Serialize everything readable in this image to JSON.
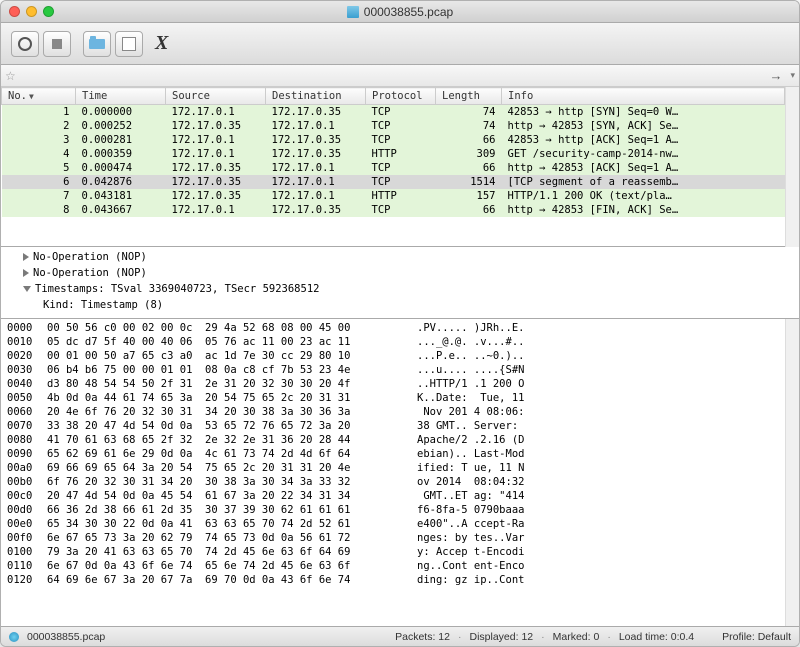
{
  "title": "000038855.pcap",
  "filter_placeholder": "",
  "columns": [
    "No.",
    "Time",
    "Source",
    "Destination",
    "Protocol",
    "Length",
    "Info"
  ],
  "sort_col": 0,
  "packets": [
    {
      "no": 1,
      "time": "0.000000",
      "src": "172.17.0.1",
      "dst": "172.17.0.35",
      "proto": "TCP",
      "len": 74,
      "info": "42853 → http [SYN] Seq=0 W…",
      "sel": false
    },
    {
      "no": 2,
      "time": "0.000252",
      "src": "172.17.0.35",
      "dst": "172.17.0.1",
      "proto": "TCP",
      "len": 74,
      "info": "http → 42853 [SYN, ACK] Se…",
      "sel": false
    },
    {
      "no": 3,
      "time": "0.000281",
      "src": "172.17.0.1",
      "dst": "172.17.0.35",
      "proto": "TCP",
      "len": 66,
      "info": "42853 → http [ACK] Seq=1 A…",
      "sel": false
    },
    {
      "no": 4,
      "time": "0.000359",
      "src": "172.17.0.1",
      "dst": "172.17.0.35",
      "proto": "HTTP",
      "len": 309,
      "info": "GET /security-camp-2014-nw…",
      "sel": false
    },
    {
      "no": 5,
      "time": "0.000474",
      "src": "172.17.0.35",
      "dst": "172.17.0.1",
      "proto": "TCP",
      "len": 66,
      "info": "http → 42853 [ACK] Seq=1 A…",
      "sel": false
    },
    {
      "no": 6,
      "time": "0.042876",
      "src": "172.17.0.35",
      "dst": "172.17.0.1",
      "proto": "TCP",
      "len": 1514,
      "info": "[TCP segment of a reassemb…",
      "sel": true
    },
    {
      "no": 7,
      "time": "0.043181",
      "src": "172.17.0.35",
      "dst": "172.17.0.1",
      "proto": "HTTP",
      "len": 157,
      "info": "HTTP/1.1 200 OK  (text/pla…",
      "sel": false
    },
    {
      "no": 8,
      "time": "0.043667",
      "src": "172.17.0.1",
      "dst": "172.17.0.35",
      "proto": "TCP",
      "len": 66,
      "info": "http → 42853 [FIN, ACK] Se…",
      "sel": false
    }
  ],
  "details": [
    {
      "indent": 1,
      "expanded": false,
      "text": "No-Operation (NOP)"
    },
    {
      "indent": 1,
      "expanded": false,
      "text": "No-Operation (NOP)"
    },
    {
      "indent": 1,
      "expanded": true,
      "text": "Timestamps: TSval 3369040723, TSecr 592368512"
    },
    {
      "indent": 2,
      "expanded": null,
      "text": "Kind: Timestamp (8)"
    }
  ],
  "hex": [
    {
      "off": "0000",
      "b": "00 50 56 c0 00 02 00 0c  29 4a 52 68 08 00 45 00",
      "a": ".PV..... )JRh..E."
    },
    {
      "off": "0010",
      "b": "05 dc d7 5f 40 00 40 06  05 76 ac 11 00 23 ac 11",
      "a": "..._@.@. .v...#.."
    },
    {
      "off": "0020",
      "b": "00 01 00 50 a7 65 c3 a0  ac 1d 7e 30 cc 29 80 10",
      "a": "...P.e.. ..~0.).."
    },
    {
      "off": "0030",
      "b": "06 b4 b6 75 00 00 01 01  08 0a c8 cf 7b 53 23 4e",
      "a": "...u.... ....{S#N"
    },
    {
      "off": "0040",
      "b": "d3 80 48 54 54 50 2f 31  2e 31 20 32 30 30 20 4f",
      "a": "..HTTP/1 .1 200 O"
    },
    {
      "off": "0050",
      "b": "4b 0d 0a 44 61 74 65 3a  20 54 75 65 2c 20 31 31",
      "a": "K..Date:  Tue, 11"
    },
    {
      "off": "0060",
      "b": "20 4e 6f 76 20 32 30 31  34 20 30 38 3a 30 36 3a",
      "a": " Nov 201 4 08:06:"
    },
    {
      "off": "0070",
      "b": "33 38 20 47 4d 54 0d 0a  53 65 72 76 65 72 3a 20",
      "a": "38 GMT.. Server: "
    },
    {
      "off": "0080",
      "b": "41 70 61 63 68 65 2f 32  2e 32 2e 31 36 20 28 44",
      "a": "Apache/2 .2.16 (D"
    },
    {
      "off": "0090",
      "b": "65 62 69 61 6e 29 0d 0a  4c 61 73 74 2d 4d 6f 64",
      "a": "ebian).. Last-Mod"
    },
    {
      "off": "00a0",
      "b": "69 66 69 65 64 3a 20 54  75 65 2c 20 31 31 20 4e",
      "a": "ified: T ue, 11 N"
    },
    {
      "off": "00b0",
      "b": "6f 76 20 32 30 31 34 20  30 38 3a 30 34 3a 33 32",
      "a": "ov 2014  08:04:32"
    },
    {
      "off": "00c0",
      "b": "20 47 4d 54 0d 0a 45 54  61 67 3a 20 22 34 31 34",
      "a": " GMT..ET ag: \"414"
    },
    {
      "off": "00d0",
      "b": "66 36 2d 38 66 61 2d 35  30 37 39 30 62 61 61 61",
      "a": "f6-8fa-5 0790baaa"
    },
    {
      "off": "00e0",
      "b": "65 34 30 30 22 0d 0a 41  63 63 65 70 74 2d 52 61",
      "a": "e400\"..A ccept-Ra"
    },
    {
      "off": "00f0",
      "b": "6e 67 65 73 3a 20 62 79  74 65 73 0d 0a 56 61 72",
      "a": "nges: by tes..Var"
    },
    {
      "off": "0100",
      "b": "79 3a 20 41 63 63 65 70  74 2d 45 6e 63 6f 64 69",
      "a": "y: Accep t-Encodi"
    },
    {
      "off": "0110",
      "b": "6e 67 0d 0a 43 6f 6e 74  65 6e 74 2d 45 6e 63 6f",
      "a": "ng..Cont ent-Enco"
    },
    {
      "off": "0120",
      "b": "64 69 6e 67 3a 20 67 7a  69 70 0d 0a 43 6f 6e 74",
      "a": "ding: gz ip..Cont"
    }
  ],
  "status": {
    "file": "000038855.pcap",
    "packets": "Packets: 12",
    "displayed": "Displayed: 12",
    "marked": "Marked: 0",
    "load": "Load time: 0:0.4",
    "profile": "Profile: Default"
  }
}
